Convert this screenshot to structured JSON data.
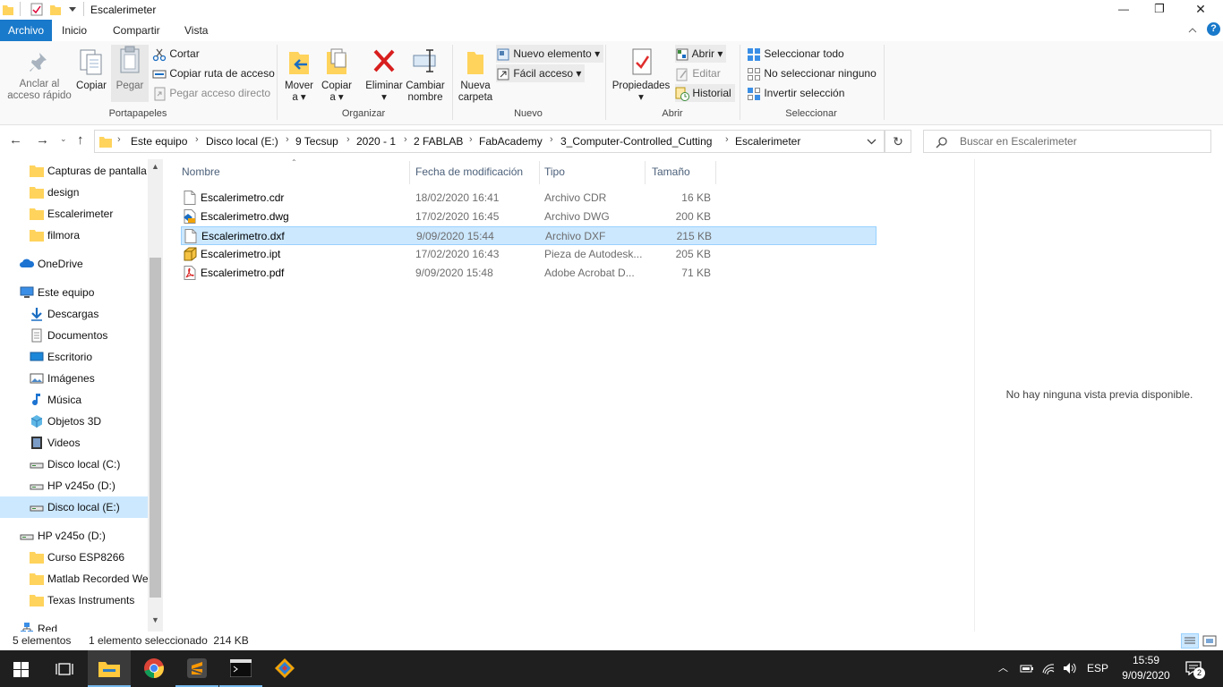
{
  "window": {
    "title": "Escalerimeter",
    "controls": {
      "minimize": "—",
      "maximize": "❐",
      "close": "✕"
    }
  },
  "menu": {
    "tabs": [
      "Archivo",
      "Inicio",
      "Compartir",
      "Vista"
    ],
    "active": "Archivo",
    "help": "?"
  },
  "ribbon": {
    "portapapeles": {
      "group_label": "Portapapeles",
      "pin_line1": "Anclar al",
      "pin_line2": "acceso rápido",
      "copy": "Copiar",
      "paste": "Pegar",
      "cut": "Cortar",
      "copy_path": "Copiar ruta de acceso",
      "paste_shortcut": "Pegar acceso directo"
    },
    "organizar": {
      "group_label": "Organizar",
      "move_line1": "Mover",
      "move_line2": "a",
      "copy_line1": "Copiar",
      "copy_line2": "a",
      "delete": "Eliminar",
      "rename_line1": "Cambiar",
      "rename_line2": "nombre"
    },
    "nuevo": {
      "group_label": "Nuevo",
      "new_folder_line1": "Nueva",
      "new_folder_line2": "carpeta",
      "new_item": "Nuevo elemento",
      "easy_access": "Fácil acceso"
    },
    "abrir": {
      "group_label": "Abrir",
      "properties": "Propiedades",
      "open": "Abrir",
      "edit": "Editar",
      "history": "Historial"
    },
    "seleccionar": {
      "group_label": "Seleccionar",
      "select_all": "Seleccionar todo",
      "select_none": "No seleccionar ninguno",
      "invert": "Invertir selección"
    }
  },
  "address": {
    "crumbs": [
      "Este equipo",
      "Disco local (E:)",
      "9 Tecsup",
      "2020 - 1",
      "2 FABLAB",
      "FabAcademy",
      "3_Computer-Controlled_Cutting",
      "Escalerimeter"
    ],
    "search_placeholder": "Buscar en Escalerimeter"
  },
  "nav": {
    "items": [
      {
        "label": "Capturas de pantalla",
        "icon": "folder-icon"
      },
      {
        "label": "design",
        "icon": "folder-icon"
      },
      {
        "label": "Escalerimeter",
        "icon": "folder-icon"
      },
      {
        "label": "filmora",
        "icon": "folder-icon"
      },
      {
        "label": "OneDrive",
        "icon": "cloud-icon"
      },
      {
        "label": "Este equipo",
        "icon": "computer-icon"
      },
      {
        "label": "Descargas",
        "icon": "download-icon"
      },
      {
        "label": "Documentos",
        "icon": "document-icon"
      },
      {
        "label": "Escritorio",
        "icon": "desktop-icon"
      },
      {
        "label": "Imágenes",
        "icon": "pictures-icon"
      },
      {
        "label": "Música",
        "icon": "music-icon"
      },
      {
        "label": "Objetos 3D",
        "icon": "cube-icon"
      },
      {
        "label": "Videos",
        "icon": "film-icon"
      },
      {
        "label": "Disco local (C:)",
        "icon": "drive-icon"
      },
      {
        "label": "HP v245o (D:)",
        "icon": "drive-icon"
      },
      {
        "label": "Disco local (E:)",
        "icon": "drive-icon"
      },
      {
        "label": "HP v245o (D:)",
        "icon": "drive-icon"
      },
      {
        "label": "Curso ESP8266",
        "icon": "folder-icon"
      },
      {
        "label": "Matlab Recorded Wel",
        "icon": "folder-icon"
      },
      {
        "label": "Texas Instruments",
        "icon": "folder-icon"
      },
      {
        "label": "Red",
        "icon": "network-icon"
      }
    ],
    "selected": "Disco local (E:)"
  },
  "columns": {
    "name": "Nombre",
    "date": "Fecha de modificación",
    "type": "Tipo",
    "size": "Tamaño"
  },
  "files": [
    {
      "name": "Escalerimetro.cdr",
      "date": "18/02/2020 16:41",
      "type": "Archivo CDR",
      "size": "16 KB",
      "icon": "file-icon"
    },
    {
      "name": "Escalerimetro.dwg",
      "date": "17/02/2020 16:45",
      "type": "Archivo DWG",
      "size": "200 KB",
      "icon": "dwg-file-icon"
    },
    {
      "name": "Escalerimetro.dxf",
      "date": "9/09/2020 15:44",
      "type": "Archivo DXF",
      "size": "215 KB",
      "icon": "file-icon"
    },
    {
      "name": "Escalerimetro.ipt",
      "date": "17/02/2020 16:43",
      "type": "Pieza de Autodesk...",
      "size": "205 KB",
      "icon": "ipt-file-icon"
    },
    {
      "name": "Escalerimetro.pdf",
      "date": "9/09/2020 15:48",
      "type": "Adobe Acrobat D...",
      "size": "71 KB",
      "icon": "pdf-file-icon"
    }
  ],
  "preview": {
    "message": "No hay ninguna vista previa disponible."
  },
  "status": {
    "count": "5 elementos",
    "selection": "1 elemento seleccionado  214 KB"
  },
  "taskbar": {
    "language": "ESP",
    "time": "15:59",
    "date": "9/09/2020",
    "notifications": "2"
  },
  "colors": {
    "accent": "#1979ca",
    "selection": "#cce8ff",
    "selection_border": "#99d1ff",
    "taskbar": "#1f1f1f",
    "folder": "#ffd35c"
  }
}
